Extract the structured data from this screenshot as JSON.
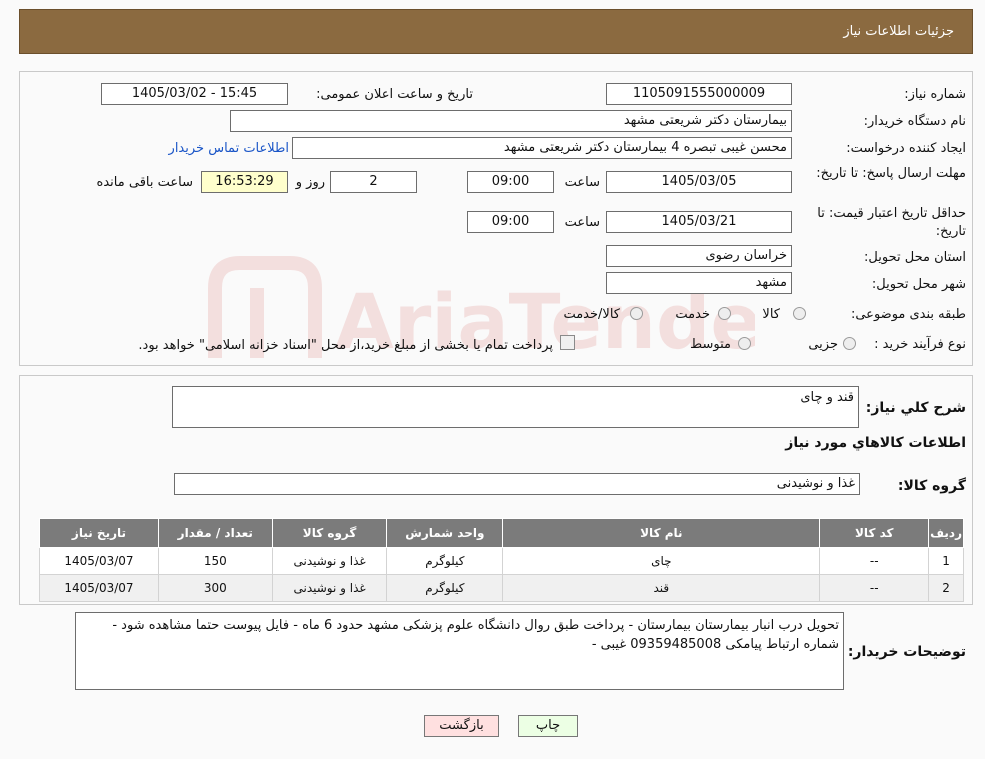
{
  "header": {
    "title": "جزئیات اطلاعات نیاز"
  },
  "fields": {
    "need_number_label": "شماره نیاز:",
    "need_number": "1105091555000009",
    "announce_label": "تاریخ و ساعت اعلان عمومی:",
    "announce_value": "1405/03/02 - 15:45",
    "buyer_org_label": "نام دستگاه خریدار:",
    "buyer_org": "بیمارستان دکتر شریعتی مشهد",
    "creator_label": "ایجاد کننده درخواست:",
    "creator": "محسن غیبی تبصره 4 بیمارستان دکتر شریعتی مشهد",
    "contact_link": "اطلاعات تماس خریدار",
    "deadline_label": "مهلت ارسال پاسخ: تا تاریخ:",
    "deadline_date": "1405/03/05",
    "time_label": "ساعت",
    "deadline_time": "09:00",
    "days": "2",
    "days_label": "روز و",
    "remaining": "16:53:29",
    "remaining_label": "ساعت باقی مانده",
    "validity_label": "حداقل تاریخ اعتبار قیمت: تا تاریخ:",
    "validity_date": "1405/03/21",
    "validity_time": "09:00",
    "province_label": "استان محل تحویل:",
    "province": "خراسان رضوی",
    "city_label": "شهر محل تحویل:",
    "city": "مشهد",
    "category_label": "طبقه بندی موضوعی:",
    "category_options": [
      "کالا",
      "خدمت",
      "کالا/خدمت"
    ],
    "process_label": "نوع فرآیند خرید :",
    "process_options": [
      "جزیی",
      "متوسط"
    ],
    "process_note": "پرداخت تمام یا بخشی از مبلغ خرید،از محل \"اسناد خزانه اسلامی\" خواهد بود."
  },
  "summary": {
    "general_desc_label": "شرح کلي نياز:",
    "general_desc": "قند و چای",
    "goods_info_title": "اطلاعات کالاهاي مورد نياز",
    "goods_group_label": "گروه کالا:",
    "goods_group": "غذا و نوشیدنی"
  },
  "table": {
    "headers": [
      "ردیف",
      "کد کالا",
      "نام کالا",
      "واحد شمارش",
      "گروه کالا",
      "تعداد / مقدار",
      "تاریخ نیاز"
    ],
    "rows": [
      [
        "1",
        "--",
        "چای",
        "کیلوگرم",
        "غذا و نوشیدنی",
        "150",
        "1405/03/07"
      ],
      [
        "2",
        "--",
        "قند",
        "کیلوگرم",
        "غذا و نوشیدنی",
        "300",
        "1405/03/07"
      ]
    ]
  },
  "notes": {
    "label": "توضیحات خریدار:",
    "text": "تحویل درب انبار بیمارستان بیمارستان - پرداخت طبق روال دانشگاه علوم پزشکی مشهد حدود 6 ماه - فایل پیوست حتما مشاهده شود  - شماره ارتباط پیامکی 09359485008 غیبی -"
  },
  "buttons": {
    "print": "چاپ",
    "back": "بازگشت"
  },
  "watermark": {
    "text": "AriaTender.neT",
    "color": "#c9302c"
  }
}
